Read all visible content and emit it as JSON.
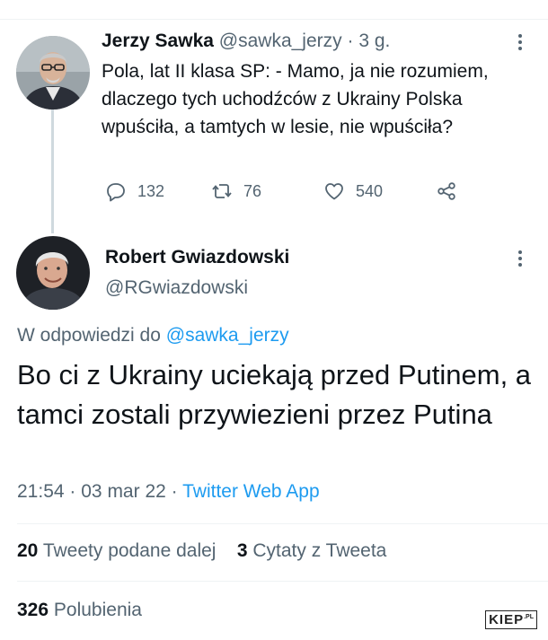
{
  "tweet_parent": {
    "author_name": "Jerzy Sawka",
    "author_handle": "@sawka_jerzy",
    "separator": "·",
    "time_ago": "3 g.",
    "text": "Pola, lat II klasa SP: - Mamo, ja nie rozumiem, dlaczego tych uchodźców z Ukrainy Polska wpuściła, a tamtych w lesie, nie wpuściła?",
    "replies": "132",
    "retweets": "76",
    "likes": "540",
    "more_icon": "more-dots-icon"
  },
  "tweet_main": {
    "author_name": "Robert Gwiazdowski",
    "author_handle": "@RGwiazdowski",
    "reply_prefix": "W odpowiedzi do",
    "reply_mention": "@sawka_jerzy",
    "text": "Bo ci z Ukrainy uciekają przed Putinem, a tamci zostali przywiezieni przez Putina",
    "time": "21:54",
    "dot": "·",
    "date": "03 mar 22",
    "app": "Twitter Web App",
    "retweets_count": "20",
    "retweets_label": "Tweety podane dalej",
    "quotes_count": "3",
    "quotes_label": "Cytaty z Tweeta",
    "likes_count": "326",
    "likes_label": "Polubienia"
  },
  "watermark": {
    "main": "KIEP",
    "suffix": ".PL"
  },
  "colors": {
    "accent": "#1d9bf0",
    "secondary_text": "#536471",
    "text": "#0f1419",
    "divider": "#eff3f4"
  }
}
